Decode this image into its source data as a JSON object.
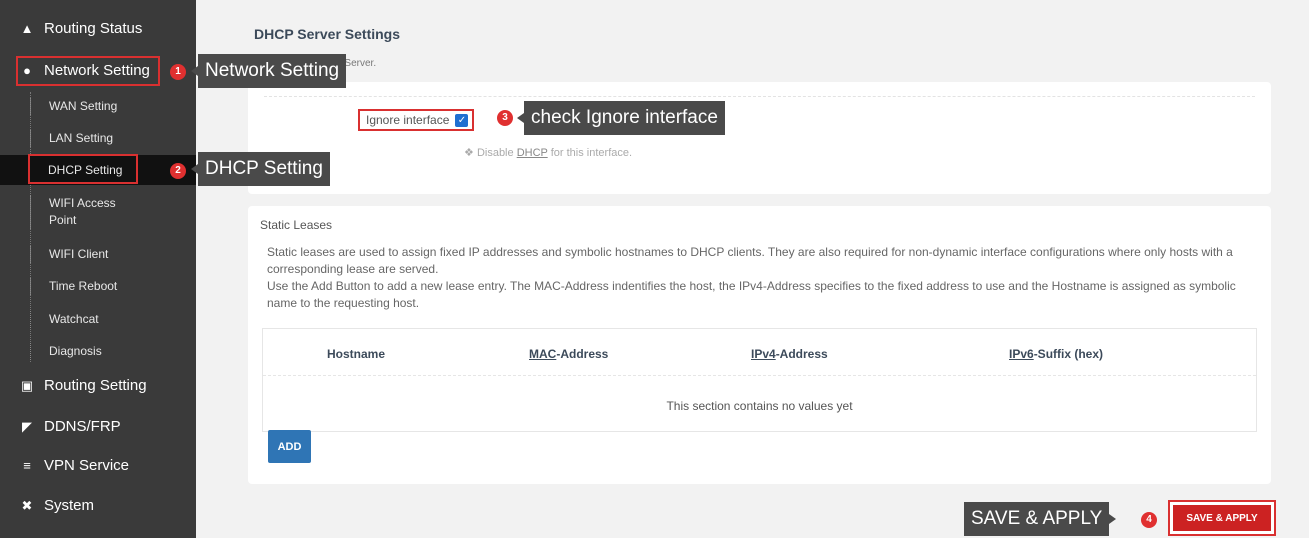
{
  "sidebar": {
    "routing_status": "Routing Status",
    "network_setting": "Network Setting",
    "wan": "WAN Setting",
    "lan": "LAN Setting",
    "dhcp": "DHCP Setting",
    "wifi_ap": "WIFI Access Point",
    "wifi_client": "WIFI Client",
    "time_reboot": "Time Reboot",
    "watchcat": "Watchcat",
    "diagnosis": "Diagnosis",
    "routing_setting": "Routing Setting",
    "ddns": "DDNS/FRP",
    "vpn": "VPN Service",
    "system": "System"
  },
  "main": {
    "title": "DHCP Server Settings",
    "desc": "Configurable DHCP Server.",
    "ignore_label": "Ignore interface",
    "hint_pre": "Disable ",
    "hint_link": "DHCP",
    "hint_post": " for this interface.",
    "static_title": "Static Leases",
    "static_text1": "Static leases are used to assign fixed IP addresses and symbolic hostnames to DHCP clients. They are also required for non-dynamic interface configurations where only hosts with a corresponding lease are served.",
    "static_text2": "Use the Add Button to add a new lease entry. The MAC-Address indentifies the host, the IPv4-Address specifies to the fixed address to use and the Hostname is assigned as symbolic name to the requesting host.",
    "col_hostname": "Hostname",
    "col_mac_a": "MAC",
    "col_mac_b": "-Address",
    "col_ipv4_a": "IPv4",
    "col_ipv4_b": "-Address",
    "col_ipv6_a": "IPv6",
    "col_ipv6_b": "-Suffix (hex)",
    "empty": "This section contains no values yet",
    "add": "ADD",
    "save": "SAVE & APPLY"
  },
  "callouts": {
    "n1": "1",
    "t1": "Network Setting",
    "n2": "2",
    "t2": "DHCP Setting",
    "n3": "3",
    "t3": "check Ignore interface",
    "n4": "4",
    "t4": "SAVE & APPLY"
  },
  "colors": {
    "highlight": "#d93030",
    "primary": "#2f75b5",
    "sidebar": "#3a3a3a"
  }
}
